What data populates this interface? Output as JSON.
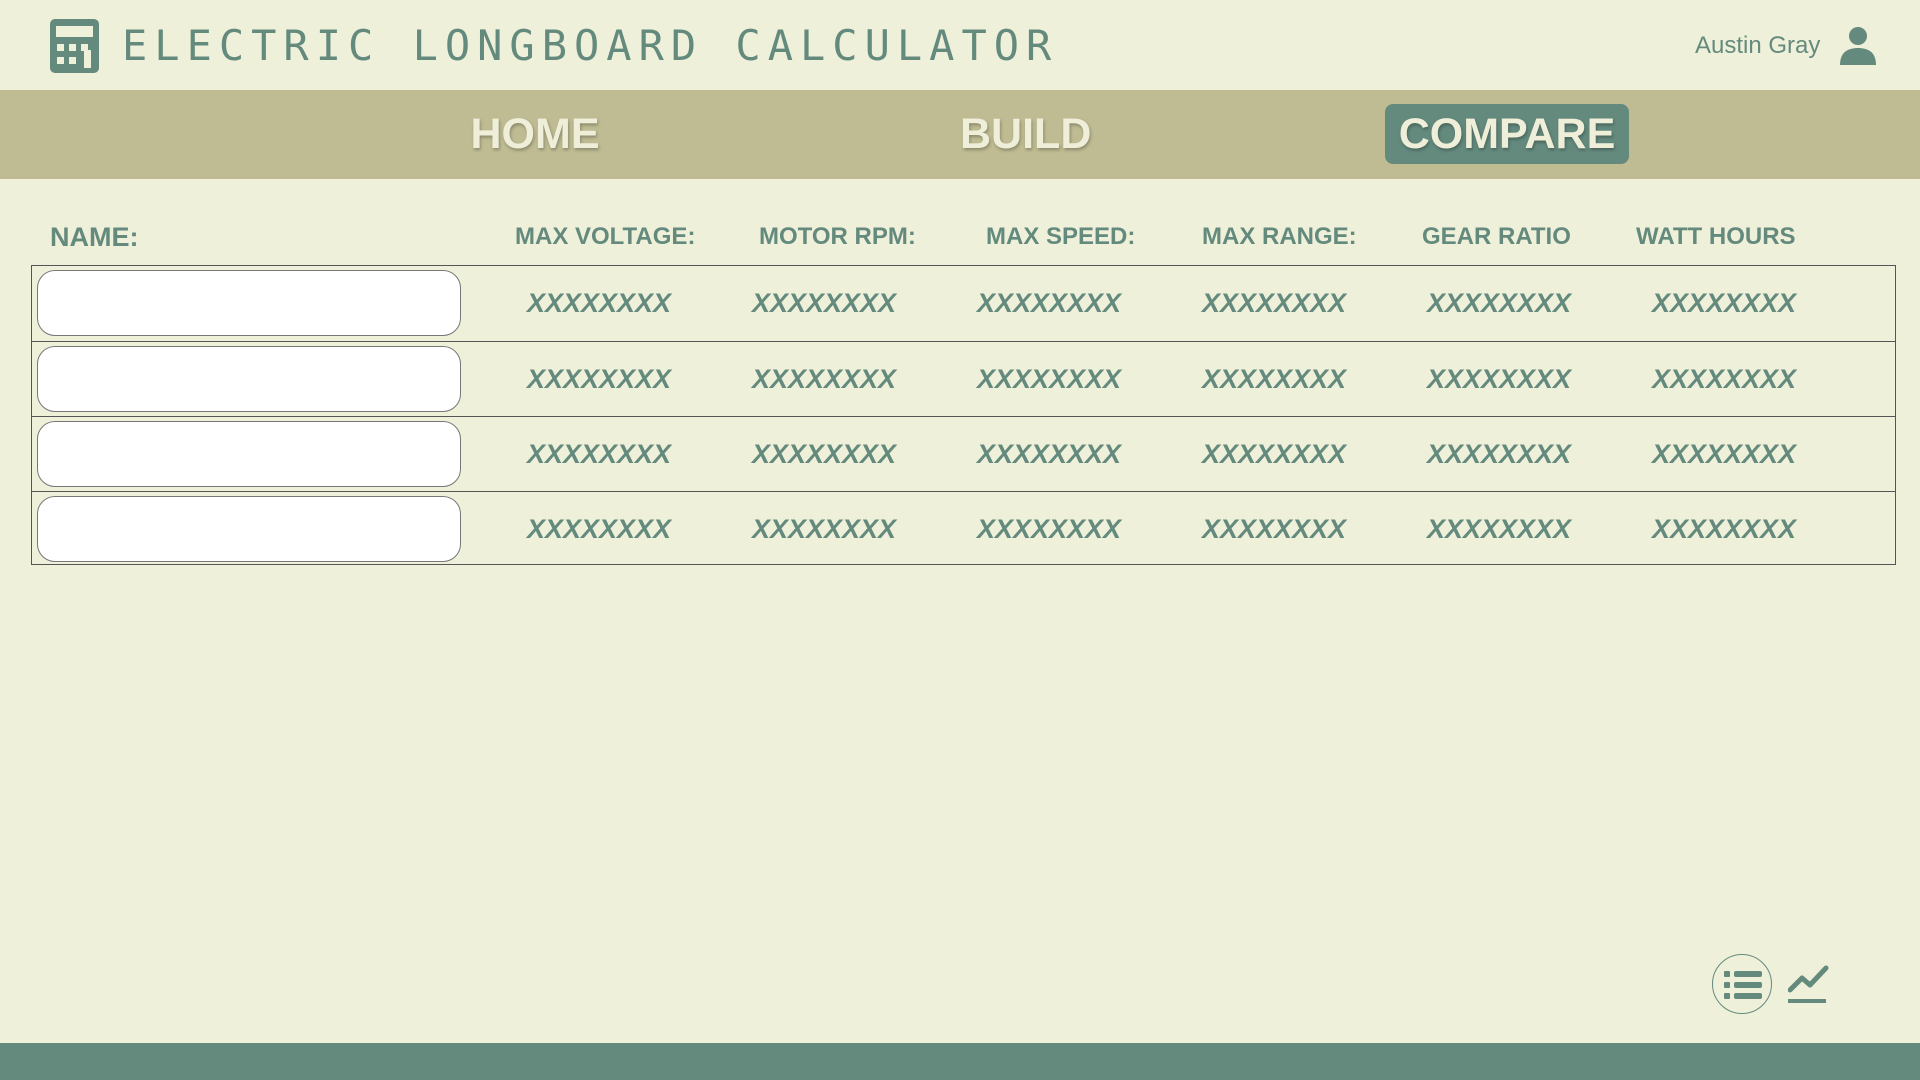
{
  "header": {
    "logo_icon": "calculator-icon",
    "title": "ELECTRIC LONGBOARD CALCULATOR",
    "user_name": "Austin Gray",
    "user_icon": "user-icon"
  },
  "nav": {
    "tabs": [
      {
        "label": "HOME"
      },
      {
        "label": "BUILD"
      },
      {
        "label": "COMPARE",
        "active": true
      }
    ]
  },
  "table": {
    "name_header": "NAME:",
    "columns": [
      "MAX VOLTAGE:",
      "MOTOR RPM:",
      "MAX SPEED:",
      "MAX RANGE:",
      "GEAR RATIO",
      "WATT HOURS"
    ],
    "rows": [
      {
        "name_value": "",
        "values": [
          "XXXXXXXX",
          "XXXXXXXX",
          "XXXXXXXX",
          "XXXXXXXX",
          "XXXXXXXX",
          "XXXXXXXX"
        ]
      },
      {
        "name_value": "",
        "values": [
          "XXXXXXXX",
          "XXXXXXXX",
          "XXXXXXXX",
          "XXXXXXXX",
          "XXXXXXXX",
          "XXXXXXXX"
        ]
      },
      {
        "name_value": "",
        "values": [
          "XXXXXXXX",
          "XXXXXXXX",
          "XXXXXXXX",
          "XXXXXXXX",
          "XXXXXXXX",
          "XXXXXXXX"
        ]
      },
      {
        "name_value": "",
        "values": [
          "XXXXXXXX",
          "XXXXXXXX",
          "XXXXXXXX",
          "XXXXXXXX",
          "XXXXXXXX",
          "XXXXXXXX"
        ]
      }
    ]
  },
  "actions": {
    "list_icon": "list-icon",
    "chart_icon": "line-chart-icon"
  },
  "colors": {
    "background": "#eff0d9",
    "nav": "#bfbc93",
    "accent": "#648a7e",
    "nav_text": "#efefd9"
  }
}
